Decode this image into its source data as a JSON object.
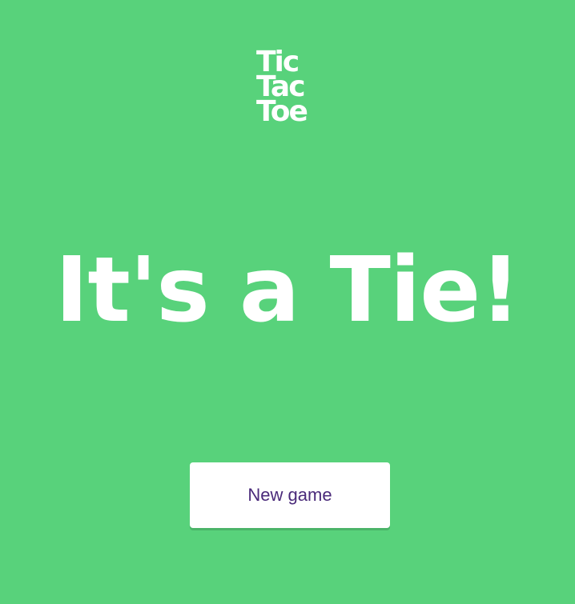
{
  "logo": {
    "lines": [
      "Tic",
      "Tac",
      "Toe"
    ]
  },
  "result": {
    "message": "It's a Tie!"
  },
  "actions": {
    "new_game_label": "New game"
  },
  "colors": {
    "background": "#58d27b",
    "text": "#ffffff",
    "button_background": "#ffffff",
    "button_text": "#4a2a7a"
  }
}
